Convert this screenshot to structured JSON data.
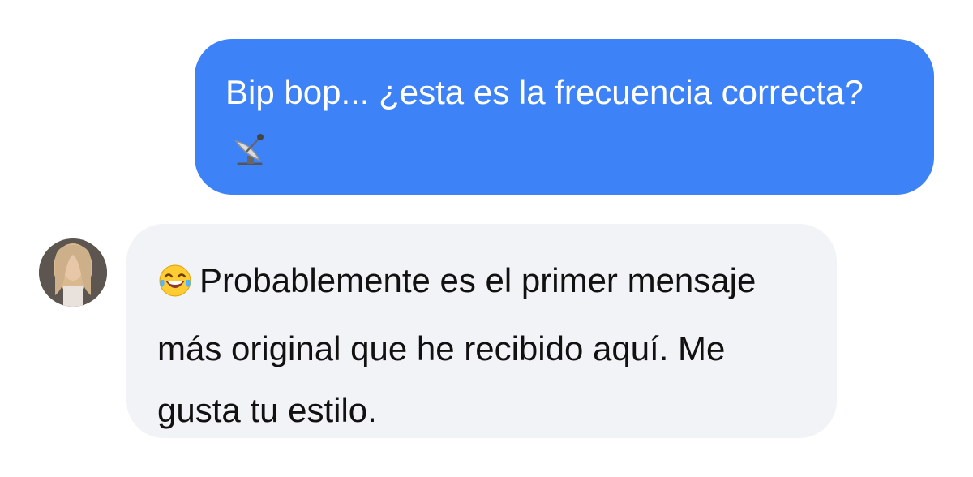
{
  "conversation": {
    "messages": [
      {
        "sender": "me",
        "text": "Bip bop... ¿esta es la frecuencia correcta?",
        "trailing_emoji": "📡",
        "trailing_emoji_icon": "satellite-antenna-icon"
      },
      {
        "sender": "contact",
        "leading_emoji": "😂",
        "leading_emoji_icon": "face-with-tears-of-joy-icon",
        "text": "Probablemente es el primer mensaje más original que he recibido aquí. Me gusta tu estilo."
      }
    ]
  },
  "colors": {
    "outgoing_bubble": "#3e82f7",
    "incoming_bubble": "#f2f3f7",
    "outgoing_text": "#ffffff",
    "incoming_text": "#111111"
  }
}
